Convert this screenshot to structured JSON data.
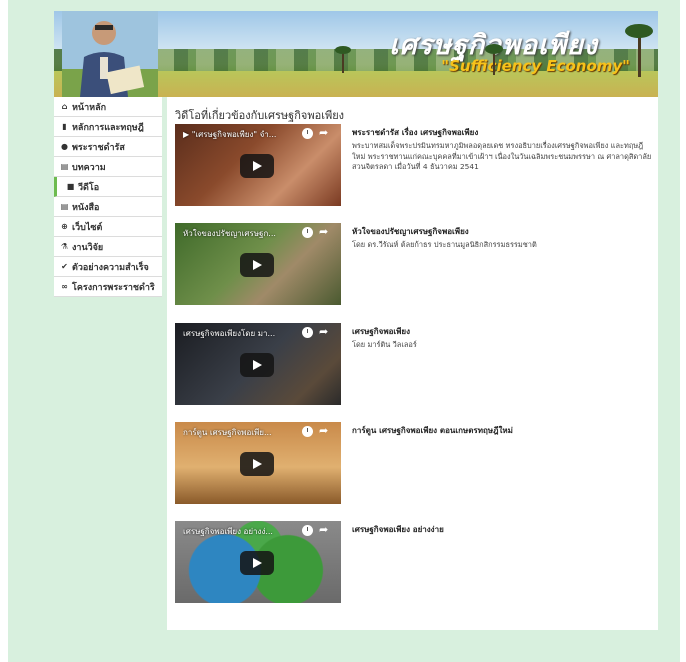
{
  "banner": {
    "title": "เศรษฐกิจพอเพียง",
    "subtitle": "\"Sufficiency Economy\""
  },
  "sidebar": {
    "items": [
      {
        "icon": "home-icon",
        "glyph": "⌂",
        "label": "หน้าหลัก",
        "active": false
      },
      {
        "icon": "map-icon",
        "glyph": "▮",
        "label": "หลักการและทฤษฎี",
        "active": false
      },
      {
        "icon": "speech-bubble-icon",
        "glyph": "●",
        "label": "พระราชดำรัส",
        "active": false
      },
      {
        "icon": "file-icon",
        "glyph": "▤",
        "label": "บทความ",
        "active": false
      },
      {
        "icon": "video-camera-icon",
        "glyph": "■",
        "label": "วีดีโอ",
        "active": true
      },
      {
        "icon": "book-icon",
        "glyph": "▤",
        "label": "หนังสือ",
        "active": false
      },
      {
        "icon": "globe-icon",
        "glyph": "⊕",
        "label": "เว็บไซต์",
        "active": false
      },
      {
        "icon": "flask-icon",
        "glyph": "⚗",
        "label": "งานวิจัย",
        "active": false
      },
      {
        "icon": "thumbs-up-icon",
        "glyph": "✔",
        "label": "ตัวอย่างความสำเร็จ",
        "active": false
      },
      {
        "icon": "link-icon",
        "glyph": "∞",
        "label": "โครงการพระราชดำริ",
        "active": false
      }
    ]
  },
  "main": {
    "heading": "วิดีโอที่เกี่ยวข้องกับเศรษฐกิจพอเพียง",
    "videos": [
      {
        "thumb_title": "▶ \"เศรษฐกิจพอเพียง\" จำ...",
        "title": "พระราชดำรัส เรื่อง เศรษฐกิจพอเพียง",
        "description": "พระบาทสมเด็จพระปรมินทรมหาภูมิพลอดุลยเดช ทรงอธิบายเรื่องเศรษฐกิจพอเพียง และทฤษฎีใหม่ พระราชทานแก่คณะบุคคลที่มาเข้าเฝ้าฯ เนื่องในวันเฉลิมพระชนมพรรษา ณ ศาลาดุสิดาลัย สวนจิตรลดา เมื่อวันที่ 4 ธันวาคม 2541",
        "bg": "linear-gradient(135deg,#5a2d1c 0%,#8a4a2c 40%,#c98d6a 70%,#7a3a22 100%)"
      },
      {
        "thumb_title": "หัวใจของปรัชญาเศรษฐก...",
        "title": "หัวใจของปรัชญาเศรษฐกิจพอเพียง",
        "description": "โดย ดร.วีรัณห์ ต้ลยก้าธร ประธานมูลนิธิกสิกรรมธรรมชาติ",
        "bg": "linear-gradient(135deg,#3f6a2a 0%,#6f8f4a 45%,#a08a68 65%,#4a5a30 100%)"
      },
      {
        "thumb_title": "เศรษฐกิจพอเพียงโดย มา...",
        "title": "เศรษฐกิจพอเพียง",
        "description": "โดย มาร์ติน วีลเลอร์",
        "bg": "linear-gradient(135deg,#1b1d22 0%,#3a3f48 50%,#5a4a3a 80%,#2a2a2a 100%)"
      },
      {
        "thumb_title": "การ์ตูน เศรษฐกิจพอเพีย...",
        "title": "การ์ตูน เศรษฐกิจพอเพียง ตอนเกษตรทฤษฎีใหม่",
        "description": "",
        "bg": "linear-gradient(180deg,#c98a4a 0%,#e0b070 55%,#8a5a2a 100%)"
      },
      {
        "thumb_title": "เศรษฐกิจพอเพียง อย่างง่...",
        "title": "เศรษฐกิจพอเพียง อย่างง่าย",
        "description": "",
        "bg": "radial-gradient(circle at 30% 60%,#2e86c1 0 28%,transparent 29%), radial-gradient(circle at 68% 60%,#3d9a3a 0 28%,transparent 29%), radial-gradient(circle at 50% 30%,#4aa84a 0 24%,transparent 25%), linear-gradient(#8a8a8a,#6a6a6a)"
      }
    ]
  }
}
